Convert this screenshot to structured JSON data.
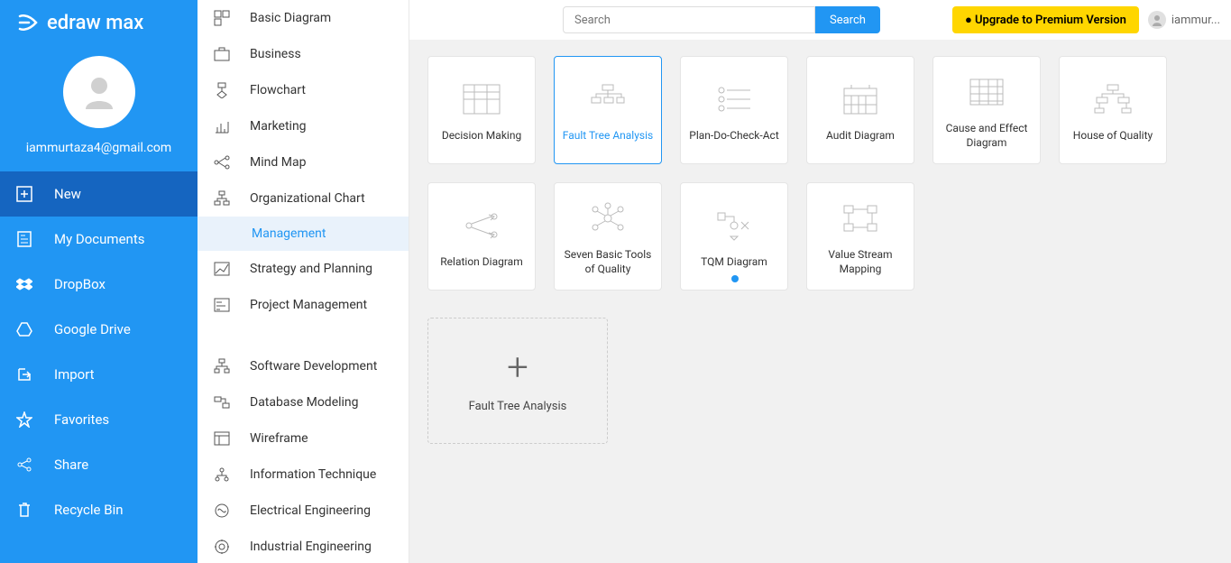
{
  "app_name": "edraw max",
  "profile": {
    "email": "iammurtaza4@gmail.com"
  },
  "nav": {
    "new": "New",
    "mydocs": "My Documents",
    "dropbox": "DropBox",
    "gdrive": "Google Drive",
    "import": "Import",
    "favorites": "Favorites",
    "share": "Share",
    "recycle": "Recycle Bin"
  },
  "categories": {
    "basic": "Basic Diagram",
    "business": "Business",
    "flowchart": "Flowchart",
    "marketing": "Marketing",
    "mindmap": "Mind Map",
    "orgchart": "Organizational Chart",
    "management": "Management",
    "strategy": "Strategy and Planning",
    "projmgmt": "Project Management",
    "softdev": "Software Development",
    "dbmodel": "Database Modeling",
    "wireframe": "Wireframe",
    "infotech": "Information Technique",
    "electrical": "Electrical Engineering",
    "industrial": "Industrial Engineering"
  },
  "topbar": {
    "search_placeholder": "Search",
    "search_button": "Search",
    "upgrade": "● Upgrade to Premium Version",
    "username": "iammur..."
  },
  "templates": {
    "decision": "Decision Making",
    "fault_tree": "Fault Tree Analysis",
    "pdca": "Plan-Do-Check-Act",
    "audit": "Audit Diagram",
    "cause_effect": "Cause and Effect Diagram",
    "house_quality": "House of Quality",
    "relation": "Relation Diagram",
    "seven_tools": "Seven Basic Tools of Quality",
    "tqm": "TQM Diagram",
    "vsm": "Value Stream Mapping"
  },
  "create": {
    "label": "Fault Tree Analysis"
  }
}
